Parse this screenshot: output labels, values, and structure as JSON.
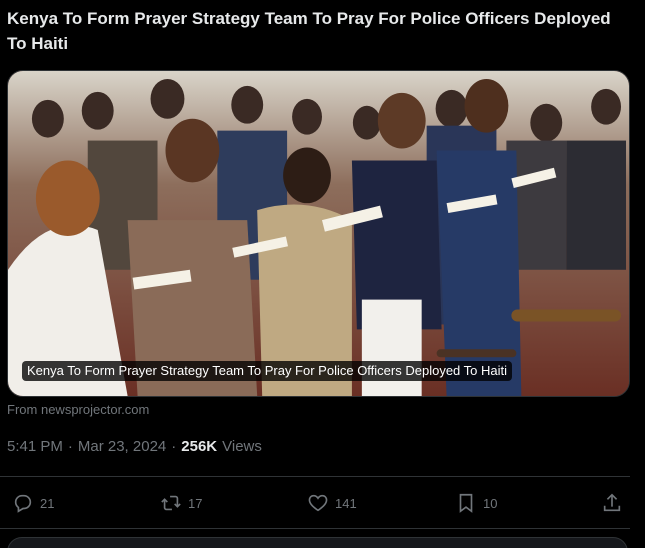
{
  "post": {
    "headline": "Kenya To Form Prayer Strategy Team To Pray For Police Officers Deployed To Haiti",
    "media_caption": "Kenya To Form Prayer Strategy Team To Pray For Police Officers Deployed To Haiti",
    "source_prefix": "From",
    "source_domain": "newsprojector.com",
    "time": "5:41 PM",
    "separator1": "·",
    "date": "Mar 23, 2024",
    "separator2": "·",
    "views_count": "256K",
    "views_label": "Views"
  },
  "actions": {
    "reply_count": "21",
    "repost_count": "17",
    "like_count": "141",
    "bookmark_count": "10"
  },
  "icons": {
    "reply": "reply-icon",
    "repost": "repost-icon",
    "like": "heart-icon",
    "bookmark": "bookmark-icon",
    "share": "share-icon"
  },
  "colors": {
    "background": "#000000",
    "text": "#e7e9ea",
    "muted": "#71767b",
    "border": "#2f3336"
  }
}
